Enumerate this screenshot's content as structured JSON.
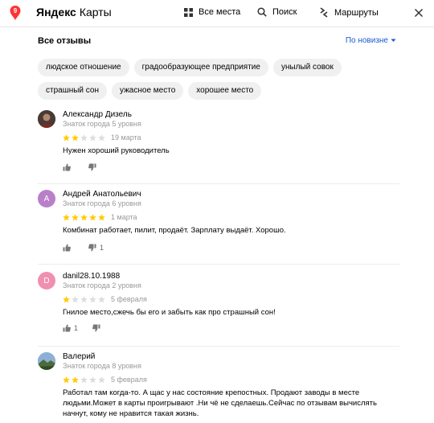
{
  "header": {
    "brand_bold": "Яндекс",
    "brand_rest": "Карты",
    "nav": [
      "Все места",
      "Поиск",
      "Маршруты"
    ]
  },
  "reviews_section": {
    "title": "Все отзывы",
    "sort_label": "По новизне"
  },
  "tags": [
    "людское отношение",
    "градообразующее предприятие",
    "унылый совок",
    "страшный сон",
    "ужасное место",
    "хорошее место"
  ],
  "reviews": [
    {
      "author": "Александр Дизель",
      "level": "Знаток города 5 уровня",
      "rating": 2,
      "date": "19 марта",
      "text": "Нужен хороший руководитель",
      "likes": "",
      "dislikes": "",
      "avatar_letter": "",
      "avatar_color": "#5a4a42"
    },
    {
      "author": "Андрей Анатольевич",
      "level": "Знаток города 6 уровня",
      "rating": 5,
      "date": "1 марта",
      "text": "Комбинат работает, пилит, продаёт. Зарплату выдаёт. Хорошо.",
      "likes": "",
      "dislikes": "1",
      "avatar_letter": "А",
      "avatar_color": "#b97fc9"
    },
    {
      "author": "danil28.10.1988",
      "level": "Знаток города 2 уровня",
      "rating": 1,
      "date": "5 февраля",
      "text": "Гнилое место,сжечь бы его и забыть как про страшный сон!",
      "likes": "1",
      "dislikes": "",
      "avatar_letter": "D",
      "avatar_color": "#f08fb0"
    },
    {
      "author": "Валерий",
      "level": "Знаток города 8 уровня",
      "rating": 2,
      "date": "5 февраля",
      "text": "Работал там когда-то. А щас у нас состояние крепостных. Продают заводы в месте людьми.Может в карты проигрывают .Ни чё не сделаешь.Сейчас по отзывам вычислять начнут, кому не нравится такая жизнь.",
      "likes": "",
      "dislikes": "",
      "avatar_letter": "",
      "avatar_color": "#6a8caf"
    }
  ],
  "colors": {
    "star_on": "#ffcc00",
    "star_off": "#dddddd",
    "link": "#1a5ad0",
    "logo": "#ff3333"
  }
}
